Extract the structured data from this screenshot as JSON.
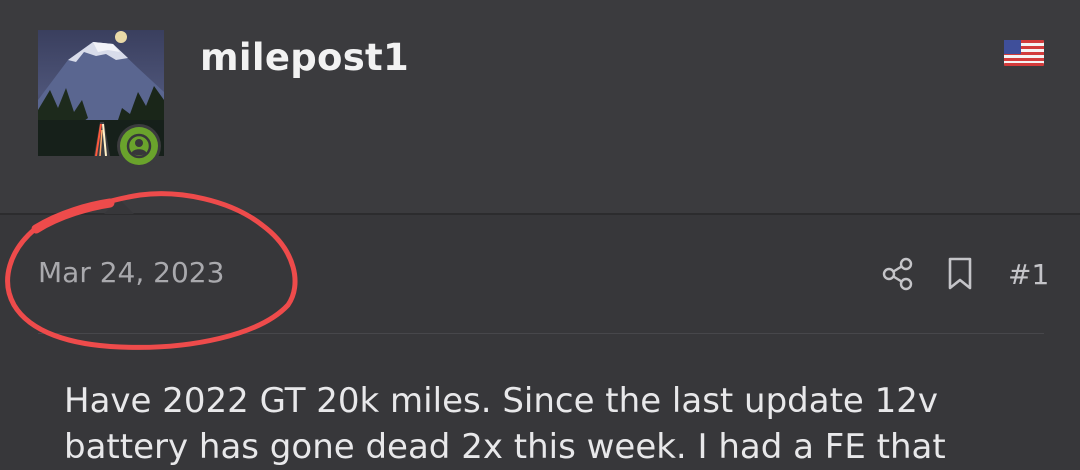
{
  "post": {
    "author": "milepost1",
    "country_flag_icon": "us-flag-icon",
    "online_status_icon": "online-user-icon",
    "date": "Mar 24, 2023",
    "post_number": "#1",
    "body": "Have 2022 GT 20k miles. Since the last update 12v battery has gone dead 2x this week. I had a FE that"
  },
  "actions": {
    "share_icon": "share-icon",
    "bookmark_icon": "bookmark-icon"
  },
  "colors": {
    "background": "#37373a",
    "header_background": "#3b3b3e",
    "online_badge": "#6aa32c",
    "annotation_red": "#ee4b4b"
  }
}
